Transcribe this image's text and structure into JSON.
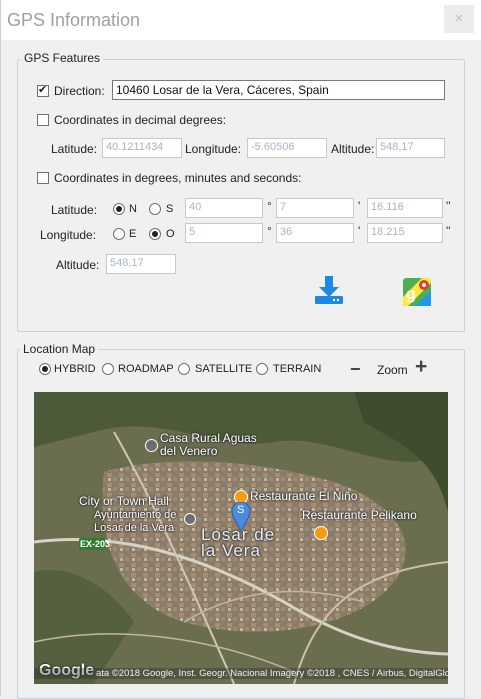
{
  "window": {
    "title": "GPS Information",
    "close_glyph": "×"
  },
  "features": {
    "legend": "GPS Features",
    "direction": {
      "label": "Direction:",
      "value": "10460 Losar de la Vera, Cáceres, Spain",
      "checked": true
    },
    "decimal": {
      "label": "Coordinates in decimal degrees:",
      "checked": false,
      "latitude_label": "Latitude:",
      "latitude_value": "40.1211434",
      "longitude_label": "Longitude:",
      "longitude_value": "-5.60506",
      "altitude_label": "Altitude:",
      "altitude_value": "548,17"
    },
    "dms": {
      "label": "Coordinates in degrees, minutes and seconds:",
      "checked": false,
      "latitude_label": "Latitude:",
      "lat_n": "N",
      "lat_s": "S",
      "lat_selected": "N",
      "lat_deg": "40",
      "lat_min": "7",
      "lat_sec": "16.116",
      "longitude_label": "Longitude:",
      "lon_e": "E",
      "lon_o": "O",
      "lon_selected": "O",
      "lon_deg": "5",
      "lon_min": "36",
      "lon_sec": "18.215",
      "deg_sym": "°",
      "min_sym": "'",
      "sec_sym": "''",
      "altitude_label": "Altitude:",
      "altitude_value": "548,17"
    },
    "icons": {
      "download": "download-icon",
      "maps": "google-maps-icon"
    }
  },
  "location_map": {
    "legend": "Location Map",
    "map_types": [
      "HYBRID",
      "ROADMAP",
      "SATELLITE",
      "TERRAIN"
    ],
    "selected_type": "HYBRID",
    "zoom_label": "Zoom",
    "zoom_minus": "−",
    "zoom_plus": "+",
    "labels": {
      "casa": "Casa Rural Aguas\ndel Venero",
      "city": "City or Town Hall",
      "ayuntamiento": "Ayuntamiento de\nLosar de la Vera",
      "restaurante_nino": "Restaurante El Niño",
      "restaurante_pelikano": "Restaurante Pelikano",
      "town": "Losar de\nla Vera",
      "road": "EX-203",
      "marker": "S",
      "google": "Google",
      "attribution": "ata ©2018 Google, Inst. Geogr. Nacional  Imagery ©2018 , CNES / Airbus, DigitalGlobe"
    }
  }
}
